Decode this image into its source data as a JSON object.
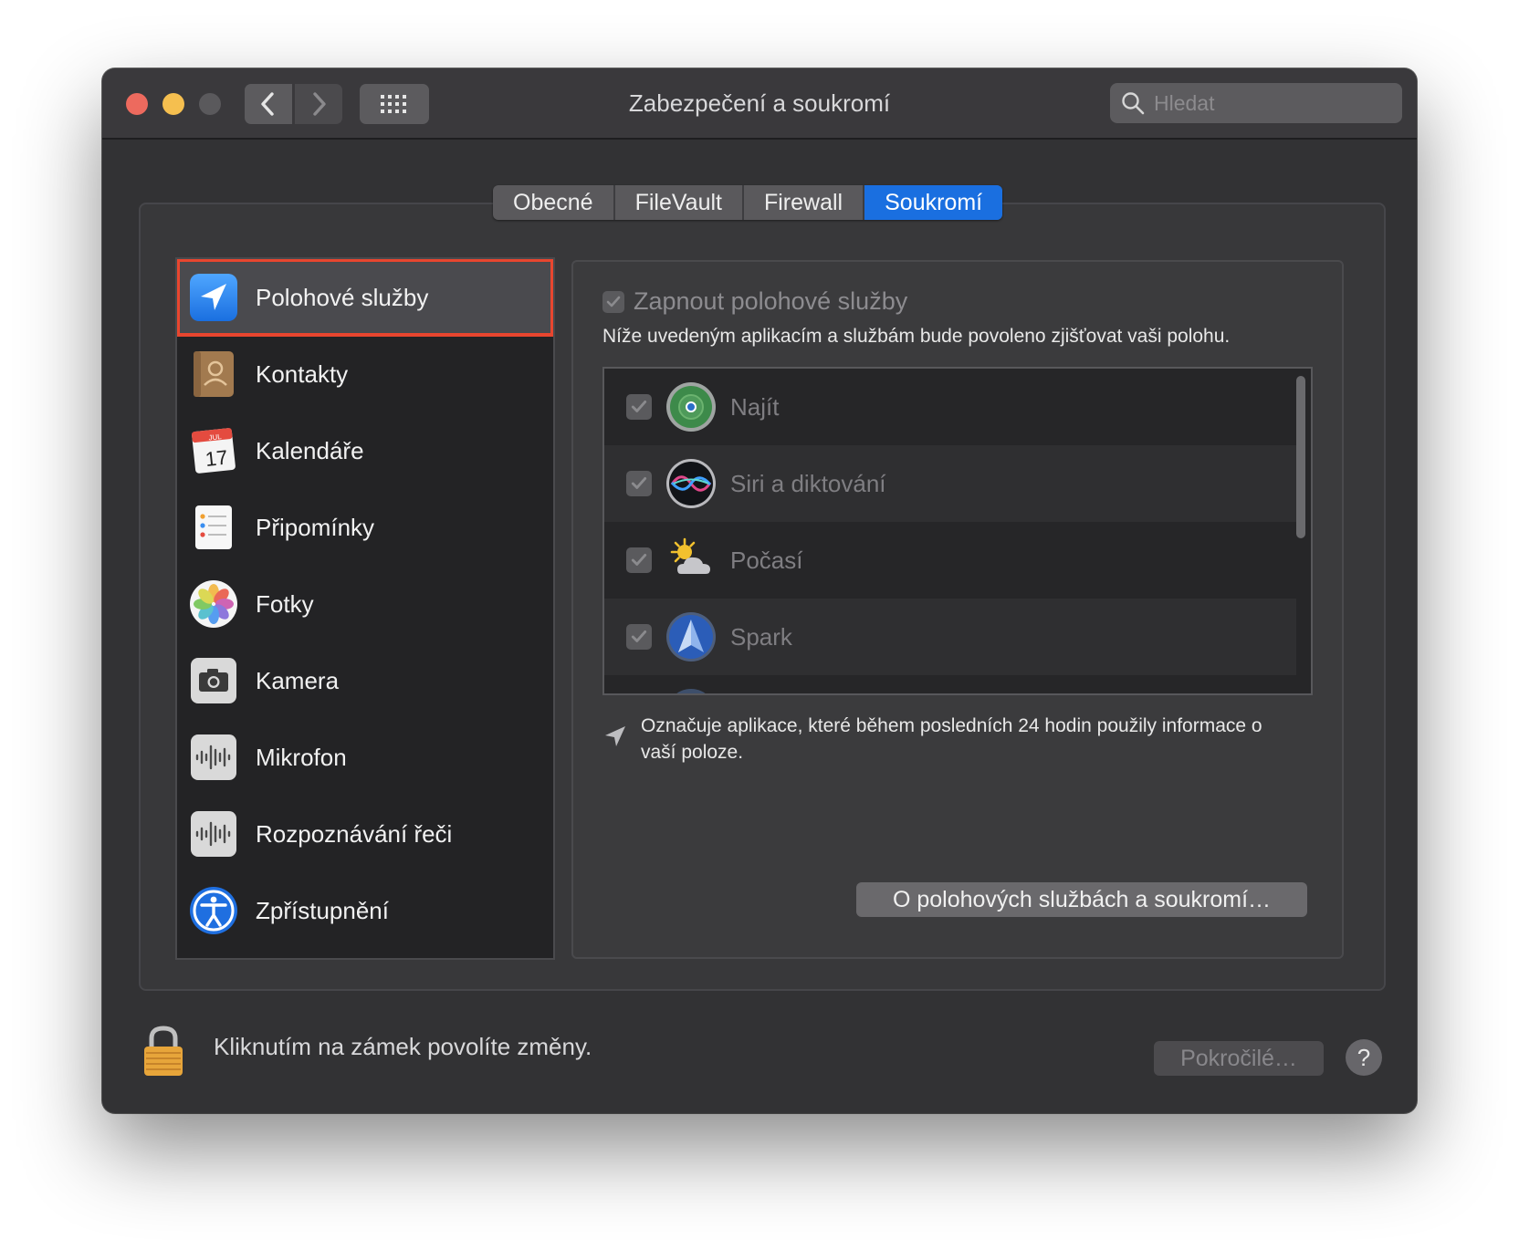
{
  "window": {
    "title": "Zabezpečení a soukromí"
  },
  "search": {
    "placeholder": "Hledat"
  },
  "tabs": [
    {
      "label": "Obecné"
    },
    {
      "label": "FileVault"
    },
    {
      "label": "Firewall"
    },
    {
      "label": "Soukromí",
      "active": true
    }
  ],
  "sidebar": {
    "items": [
      {
        "label": "Polohové služby",
        "icon": "location-arrow-icon",
        "selected": true
      },
      {
        "label": "Kontakty",
        "icon": "contacts-icon"
      },
      {
        "label": "Kalendáře",
        "icon": "calendar-icon"
      },
      {
        "label": "Připomínky",
        "icon": "reminders-icon"
      },
      {
        "label": "Fotky",
        "icon": "photos-icon"
      },
      {
        "label": "Kamera",
        "icon": "camera-icon"
      },
      {
        "label": "Mikrofon",
        "icon": "microphone-icon"
      },
      {
        "label": "Rozpoznávání řeči",
        "icon": "speech-recognition-icon"
      },
      {
        "label": "Zpřístupnění",
        "icon": "accessibility-icon"
      }
    ]
  },
  "calendar_icon": {
    "month": "JUL",
    "day": "17"
  },
  "location": {
    "enable_label": "Zapnout polohové služby",
    "enabled": true,
    "description": "Níže uvedeným aplikacím a službám bude povoleno zjišťovat vaši polohu.",
    "apps": [
      {
        "label": "Najít",
        "icon": "find-my-icon",
        "checked": true
      },
      {
        "label": "Siri a diktování",
        "icon": "siri-icon",
        "checked": true
      },
      {
        "label": "Počasí",
        "icon": "weather-icon",
        "checked": true
      },
      {
        "label": "Spark",
        "icon": "spark-icon",
        "checked": true
      }
    ],
    "legend_text": "Označuje aplikace, které během posledních 24 hodin použily informace o vaší poloze.",
    "about_button": "O polohových službách a soukromí…"
  },
  "footer": {
    "lock_text": "Kliknutím na zámek povolíte změny.",
    "advanced_button": "Pokročilé…",
    "help_button": "?"
  },
  "colors": {
    "accent": "#1a6fe0",
    "selection_outline": "#e8462f",
    "window_bg": "#323234"
  }
}
